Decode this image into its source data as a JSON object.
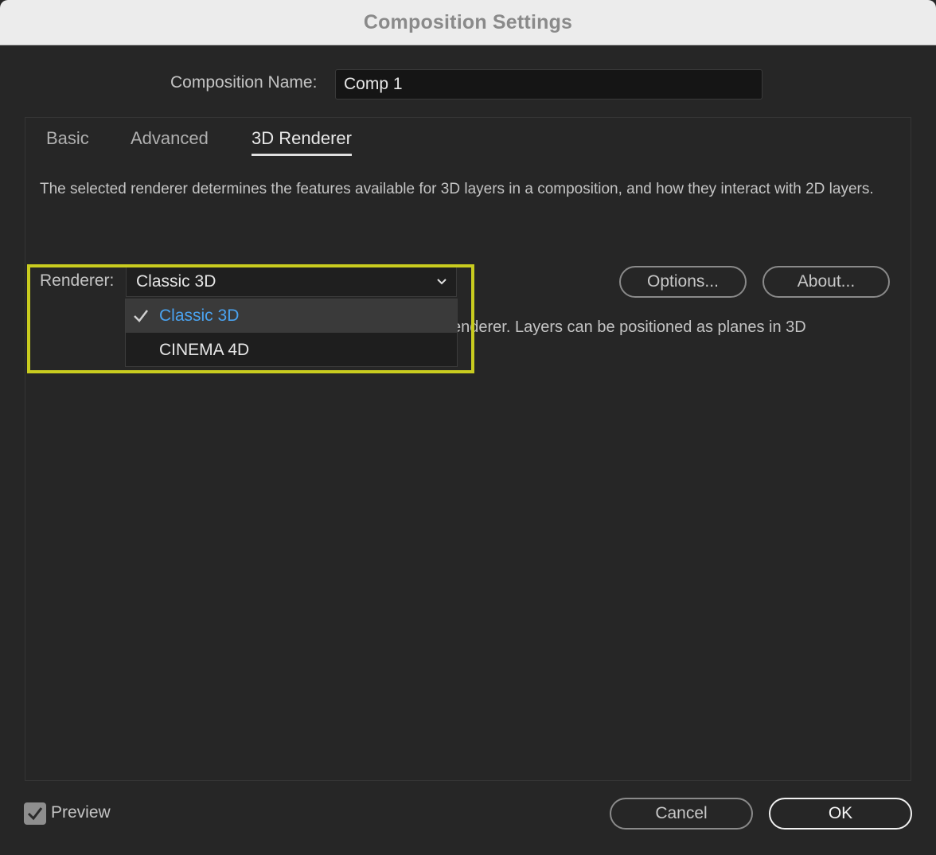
{
  "window": {
    "title": "Composition Settings"
  },
  "composition": {
    "name_label": "Composition Name:",
    "name_value": "Comp 1"
  },
  "tabs": [
    {
      "label": "Basic",
      "active": false
    },
    {
      "label": "Advanced",
      "active": false
    },
    {
      "label": "3D Renderer",
      "active": true
    }
  ],
  "renderer_tab": {
    "description": "The selected renderer determines the features available for 3D layers in a composition, and how they interact with 2D layers.",
    "renderer_label": "Renderer:",
    "selected_value": "Classic 3D",
    "options": [
      {
        "label": "Classic 3D",
        "checked": true
      },
      {
        "label": "CINEMA 4D",
        "checked": false
      }
    ],
    "partial_text": "enderer. Layers can be positioned as planes in 3D",
    "options_button": "Options...",
    "about_button": "About..."
  },
  "footer": {
    "preview_label": "Preview",
    "preview_checked": true,
    "cancel_label": "Cancel",
    "ok_label": "OK"
  },
  "colors": {
    "highlight": "#c9cc1f",
    "selected_item_text": "#4aa3f0"
  }
}
